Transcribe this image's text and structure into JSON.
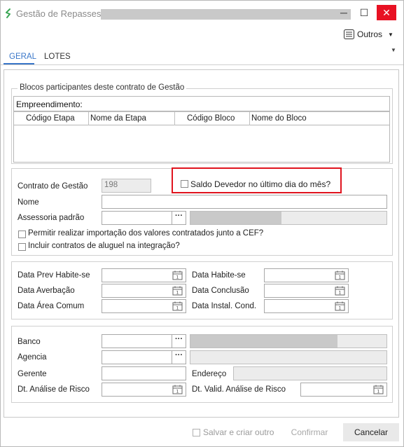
{
  "window": {
    "title": "Gestão de Repasses",
    "controls": {
      "minimize": "─",
      "maximize": "☐",
      "close": "✕"
    }
  },
  "toolbar": {
    "outros_label": "Outros"
  },
  "tabs": [
    {
      "label": "GERAL",
      "active": true
    },
    {
      "label": "LOTES",
      "active": false
    }
  ],
  "blocos": {
    "group_title": "Blocos participantes deste contrato de Gestão",
    "empreendimento_label": "Empreendimento:",
    "columns": [
      "Código Etapa",
      "Nome da Etapa",
      "Código Bloco",
      "Nome do Bloco"
    ]
  },
  "contrato": {
    "contrato_label": "Contrato de Gestão",
    "contrato_value": "198",
    "saldo_devedor_label": "Saldo Devedor no último dia do mês?",
    "nome_label": "Nome",
    "nome_value": "",
    "assessoria_label": "Assessoria padrão",
    "lookup_button": "···",
    "permitir_label": "Permitir realizar importação dos valores contratados junto a CEF?",
    "incluir_label": "Incluir contratos de aluguel na integração?"
  },
  "datas": {
    "prev_habite_se": "Data Prev Habite-se",
    "habite_se": "Data Habite-se",
    "averbacao": "Data Averbação",
    "conclusao": "Data Conclusão",
    "area_comum": "Data Área Comum",
    "instal_cond": "Data Instal. Cond."
  },
  "banco": {
    "banco_label": "Banco",
    "agencia_label": "Agencia",
    "gerente_label": "Gerente",
    "endereco_label": "Endereço",
    "dt_analise_label": "Dt. Análise de Risco",
    "dt_valid_label": "Dt. Valid. Análise de Risco"
  },
  "footer": {
    "salvar_criar_label": "Salvar e criar outro",
    "confirmar_label": "Confirmar",
    "cancelar_label": "Cancelar"
  },
  "colors": {
    "accent": "#3a77c9",
    "highlight": "#e0141e",
    "close": "#e81123"
  }
}
